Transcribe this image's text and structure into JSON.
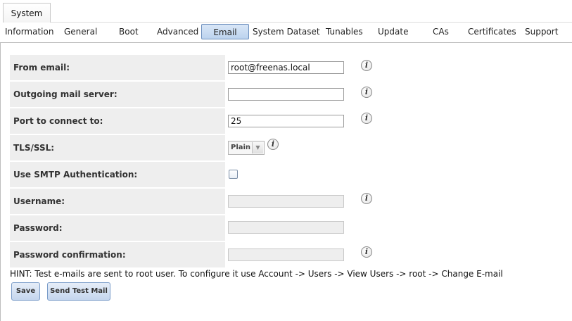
{
  "top_tab": {
    "label": "System"
  },
  "subtabs": [
    {
      "label": "Information"
    },
    {
      "label": "General"
    },
    {
      "label": "Boot"
    },
    {
      "label": "Advanced"
    },
    {
      "label": "Email",
      "active": true
    },
    {
      "label": "System Dataset"
    },
    {
      "label": "Tunables"
    },
    {
      "label": "Update"
    },
    {
      "label": "CAs"
    },
    {
      "label": "Certificates"
    },
    {
      "label": "Support"
    }
  ],
  "form": {
    "from_email": {
      "label": "From email:",
      "value": "root@freenas.local"
    },
    "outgoing_mail_server": {
      "label": "Outgoing mail server:",
      "value": ""
    },
    "port": {
      "label": "Port to connect to:",
      "value": "25"
    },
    "tls_ssl": {
      "label": "TLS/SSL:",
      "selected": "Plain"
    },
    "smtp_auth": {
      "label": "Use SMTP Authentication:",
      "checked": false
    },
    "username": {
      "label": "Username:",
      "value": ""
    },
    "password": {
      "label": "Password:",
      "value": ""
    },
    "password_confirmation": {
      "label": "Password confirmation:",
      "value": ""
    }
  },
  "info_icon_glyph": "i",
  "select_arrow_glyph": "▼",
  "hint": "HINT: Test e-mails are sent to root user. To configure it use Account -> Users -> View Users -> root -> Change E-mail",
  "buttons": {
    "save": "Save",
    "send_test_mail": "Send Test Mail"
  },
  "colors": {
    "active_tab": "#c4d8f0",
    "label_bg": "#eeeeee",
    "button_border": "#7a9cc8"
  }
}
